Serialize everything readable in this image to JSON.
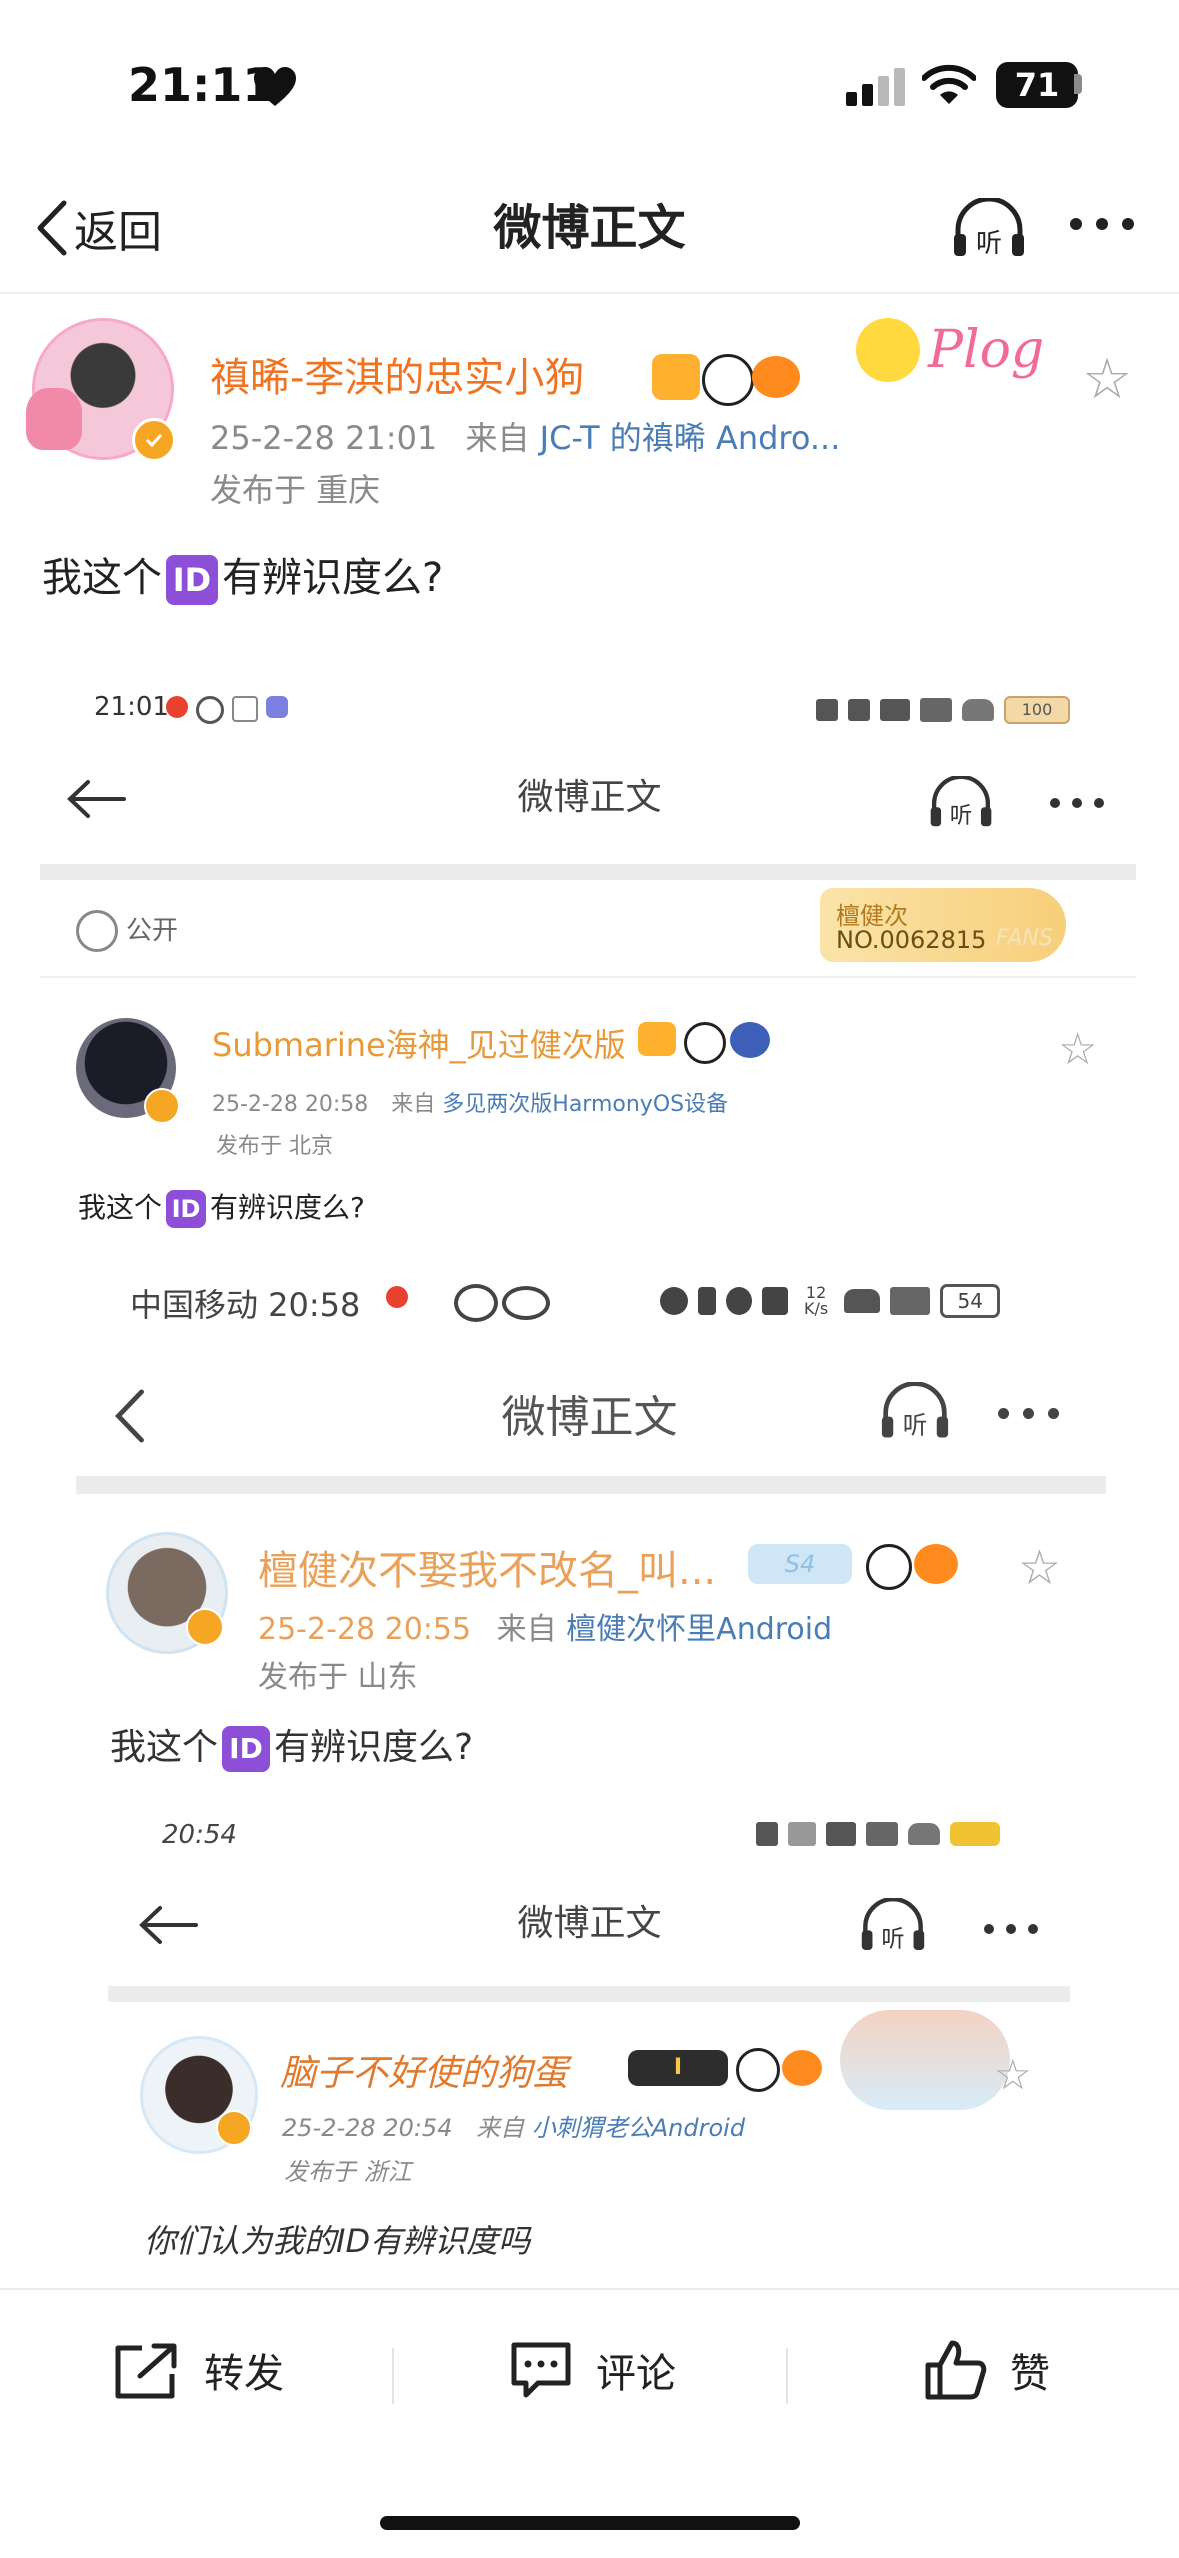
{
  "status_bar": {
    "time": "21:11",
    "battery": "71"
  },
  "nav": {
    "back_label": "返回",
    "title": "微博正文"
  },
  "post": {
    "author": "禛晞-李淇的忠实小狗",
    "date": "25-2-28 21:01",
    "source_prefix": "来自",
    "source": "JC-T 的禛晞 Andro...",
    "location": "发布于 重庆",
    "text_before": "我这个",
    "id_badge": "ID",
    "text_after": "有辨识度么?",
    "plog": "Plog"
  },
  "shot1": {
    "time": "21:01",
    "battery": "100",
    "title": "微博正文",
    "visibility": "公开",
    "fans_name": "檀健次",
    "fans_no": "NO.0062815",
    "fans_tag": "FANS",
    "author": "Submarine海神_见过健次版",
    "date": "25-2-28 20:58",
    "source_prefix": "来自",
    "source": "多见两次版HarmonyOS设备",
    "location": "发布于 北京",
    "text_before": "我这个",
    "text_after": "有辨识度么?"
  },
  "shot2": {
    "carrier_time": "中国移动 20:58",
    "speed_value": "12",
    "speed_unit": "K/s",
    "battery": "54",
    "title": "微博正文",
    "author": "檀健次不娶我不改名_叫...",
    "level_badge": "S4",
    "date": "25-2-28 20:55",
    "source_prefix": "来自",
    "source": "檀健次怀里Android",
    "location": "发布于 山东",
    "text_before": "我这个",
    "text_after": "有辨识度么?"
  },
  "shot3": {
    "time": "20:54",
    "title": "微博正文",
    "author": "脑子不好使的狗蛋",
    "level_badge": "I",
    "date": "25-2-28 20:54",
    "source_prefix": "来自",
    "source": "小刺猬老公Android",
    "location": "发布于 浙江",
    "text": "你们认为我的ID有辨识度吗"
  },
  "actions": {
    "repost": "转发",
    "comment": "评论",
    "like": "赞"
  },
  "colors": {
    "name_orange": "#f07322",
    "link_blue": "#4a7db5",
    "id_purple": "#8e4fd8",
    "verified_orange": "#f5a623"
  }
}
